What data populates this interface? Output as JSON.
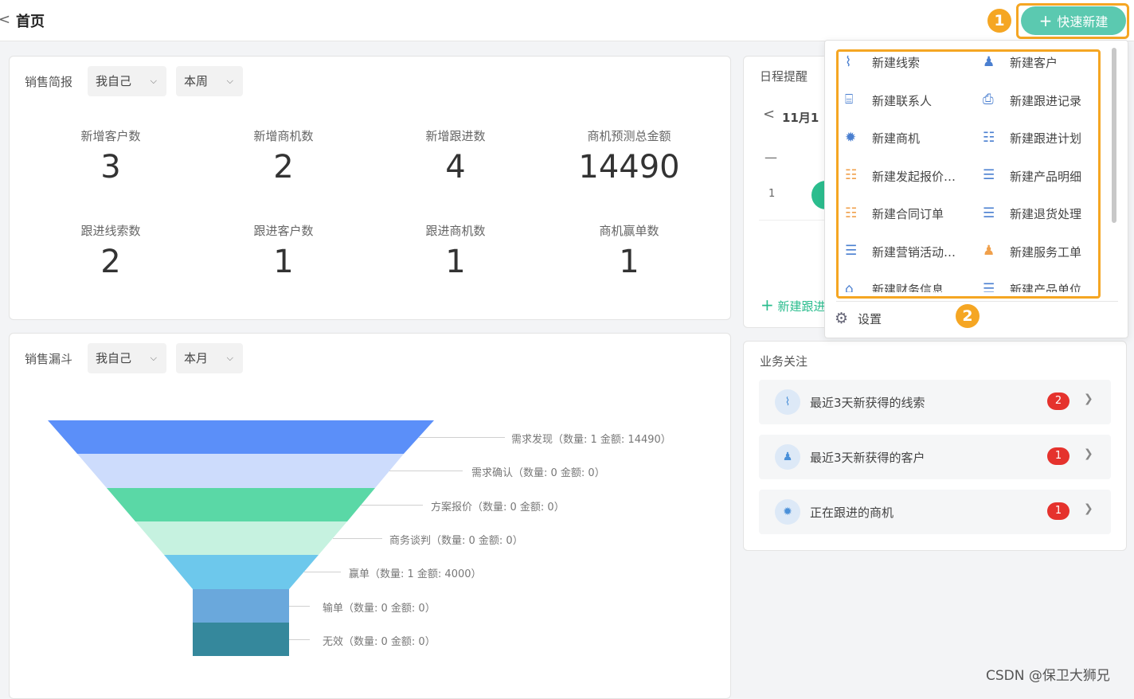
{
  "header": {
    "back": "<",
    "title": "首页"
  },
  "quick_create": {
    "label": "快速新建",
    "plus": "+"
  },
  "annotations": {
    "one": "1",
    "two": "2"
  },
  "briefing": {
    "title": "销售简报",
    "scope": "我自己",
    "period": "本周",
    "stats": [
      {
        "label": "新增客户数",
        "value": "3"
      },
      {
        "label": "新增商机数",
        "value": "2"
      },
      {
        "label": "新增跟进数",
        "value": "4"
      },
      {
        "label": "商机预测总金额",
        "value": "14490"
      },
      {
        "label": "跟进线索数",
        "value": "2"
      },
      {
        "label": "跟进客户数",
        "value": "1"
      },
      {
        "label": "跟进商机数",
        "value": "1"
      },
      {
        "label": "商机赢单数",
        "value": "1"
      }
    ]
  },
  "funnel": {
    "title": "销售漏斗",
    "scope": "我自己",
    "period": "本月",
    "stages": [
      {
        "label": "需求发现（数量: 1 金额: 14490）",
        "color": "#5b8ff9"
      },
      {
        "label": "需求确认（数量: 0 金额: 0）",
        "color": "#cddcfc"
      },
      {
        "label": "方案报价（数量: 0 金额: 0）",
        "color": "#5ad8a6"
      },
      {
        "label": "商务谈判（数量: 0 金额: 0）",
        "color": "#c6f2e0"
      },
      {
        "label": "赢单（数量: 1 金额: 4000）",
        "color": "#6dc8ec"
      },
      {
        "label": "输单（数量: 0 金额: 0）",
        "color": "#6aa8dc"
      },
      {
        "label": "无效（数量: 0 金额: 0）",
        "color": "#35889c"
      }
    ]
  },
  "schedule": {
    "title": "日程提醒",
    "date": "11月1",
    "prev": "<",
    "dash": "—",
    "row_num": "1",
    "new_followup": "新建跟进"
  },
  "quick_menu": {
    "items": [
      {
        "label": "新建线索",
        "icon": "lead-icon"
      },
      {
        "label": "新建客户",
        "icon": "customer-icon"
      },
      {
        "label": "新建联系人",
        "icon": "contact-icon"
      },
      {
        "label": "新建跟进记录",
        "icon": "followup-record-icon"
      },
      {
        "label": "新建商机",
        "icon": "opportunity-icon"
      },
      {
        "label": "新建跟进计划",
        "icon": "followup-plan-icon"
      },
      {
        "label": "新建发起报价…",
        "icon": "quote-icon"
      },
      {
        "label": "新建产品明细",
        "icon": "product-detail-icon"
      },
      {
        "label": "新建合同订单",
        "icon": "contract-icon"
      },
      {
        "label": "新建退货处理",
        "icon": "return-icon"
      },
      {
        "label": "新建营销活动…",
        "icon": "campaign-icon"
      },
      {
        "label": "新建服务工单",
        "icon": "service-ticket-icon"
      },
      {
        "label": "新建财务信息",
        "icon": "finance-icon"
      },
      {
        "label": "新建产品单位",
        "icon": "product-unit-icon"
      }
    ],
    "settings": "设置"
  },
  "business": {
    "title": "业务关注",
    "rows": [
      {
        "label": "最近3天新获得的线索",
        "count": "2"
      },
      {
        "label": "最近3天新获得的客户",
        "count": "1"
      },
      {
        "label": "正在跟进的商机",
        "count": "1"
      }
    ]
  },
  "watermark": "CSDN @保卫大狮兄"
}
